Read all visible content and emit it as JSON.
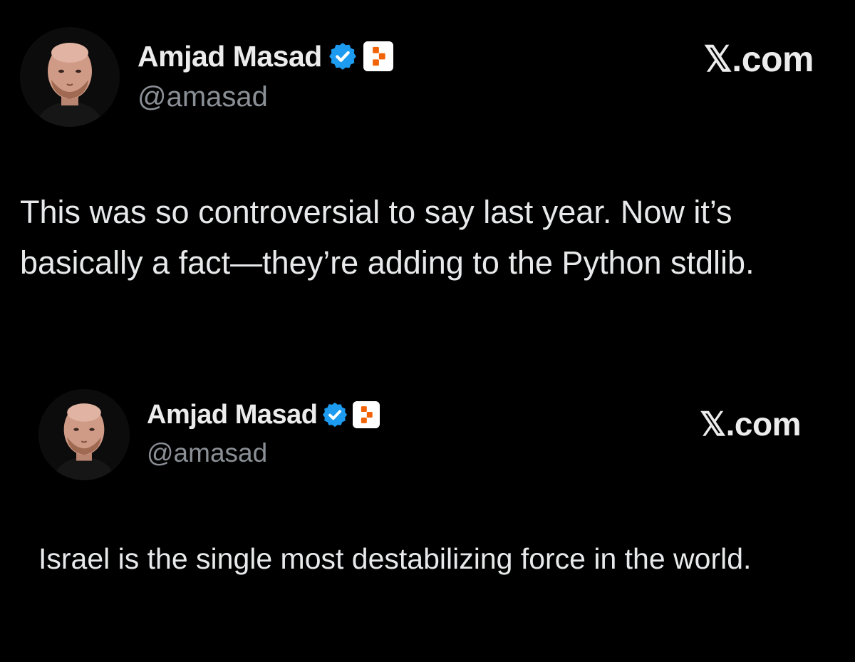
{
  "main_tweet": {
    "author": {
      "display_name": "Amjad Masad",
      "handle": "@amasad",
      "verified": true,
      "verified_color": "#1d9bf0",
      "affiliate_badge": "replit-logo-icon",
      "affiliate_color": "#f26207"
    },
    "source": "𝕏.com",
    "text": "This was so controversial to say last year. Now it’s basically a fact—they’re adding to the Python stdlib."
  },
  "quoted_tweet": {
    "author": {
      "display_name": "Amjad Masad",
      "handle": "@amasad",
      "verified": true,
      "verified_color": "#1d9bf0",
      "affiliate_badge": "replit-logo-icon",
      "affiliate_color": "#f26207"
    },
    "source": "𝕏.com",
    "text": "Israel is the single most destabilizing force in the world."
  },
  "theme": {
    "background": "#000000",
    "text_primary": "#e7e9ea",
    "text_secondary": "#8b9096"
  }
}
